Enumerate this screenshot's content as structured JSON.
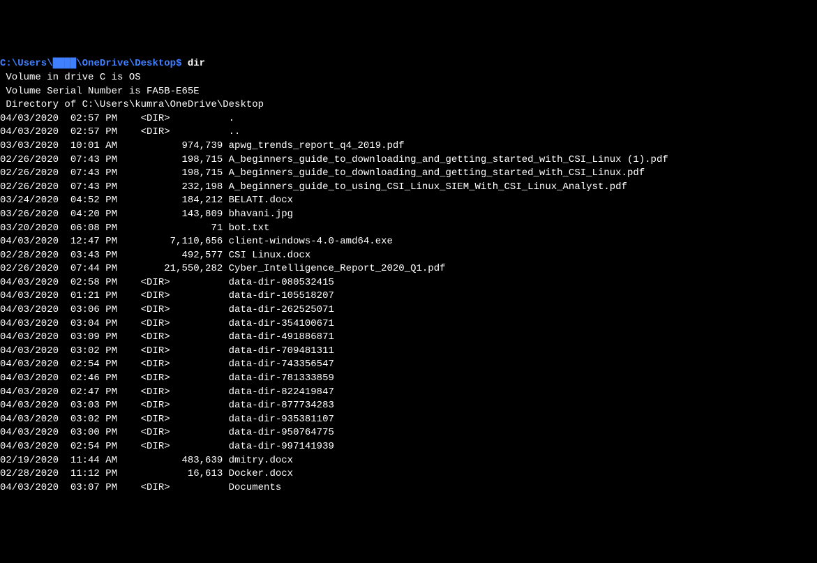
{
  "prompt": {
    "prefix": "C:\\Users\\",
    "obscured": "████",
    "suffix": "\\OneDrive\\Desktop",
    "dollar": "$",
    "command": "dir"
  },
  "header": {
    "volume_label": " Volume in drive C is OS",
    "serial": " Volume Serial Number is FA5B-E65E",
    "blank": "",
    "directory_of": " Directory of C:\\Users\\kumra\\OneDrive\\Desktop",
    "blank2": ""
  },
  "entries": [
    {
      "date": "04/03/2020",
      "time": "02:57 PM",
      "dir": "<DIR>",
      "size": "",
      "name": "."
    },
    {
      "date": "04/03/2020",
      "time": "02:57 PM",
      "dir": "<DIR>",
      "size": "",
      "name": ".."
    },
    {
      "date": "03/03/2020",
      "time": "10:01 AM",
      "dir": "",
      "size": "974,739",
      "name": "apwg_trends_report_q4_2019.pdf"
    },
    {
      "date": "02/26/2020",
      "time": "07:43 PM",
      "dir": "",
      "size": "198,715",
      "name": "A_beginners_guide_to_downloading_and_getting_started_with_CSI_Linux (1).pdf"
    },
    {
      "date": "02/26/2020",
      "time": "07:43 PM",
      "dir": "",
      "size": "198,715",
      "name": "A_beginners_guide_to_downloading_and_getting_started_with_CSI_Linux.pdf"
    },
    {
      "date": "02/26/2020",
      "time": "07:43 PM",
      "dir": "",
      "size": "232,198",
      "name": "A_beginners_guide_to_using_CSI_Linux_SIEM_With_CSI_Linux_Analyst.pdf"
    },
    {
      "date": "03/24/2020",
      "time": "04:52 PM",
      "dir": "",
      "size": "184,212",
      "name": "BELATI.docx"
    },
    {
      "date": "03/26/2020",
      "time": "04:20 PM",
      "dir": "",
      "size": "143,809",
      "name": "bhavani.jpg"
    },
    {
      "date": "03/20/2020",
      "time": "06:08 PM",
      "dir": "",
      "size": "71",
      "name": "bot.txt"
    },
    {
      "date": "04/03/2020",
      "time": "12:47 PM",
      "dir": "",
      "size": "7,110,656",
      "name": "client-windows-4.0-amd64.exe"
    },
    {
      "date": "02/28/2020",
      "time": "03:43 PM",
      "dir": "",
      "size": "492,577",
      "name": "CSI Linux.docx"
    },
    {
      "date": "02/26/2020",
      "time": "07:44 PM",
      "dir": "",
      "size": "21,550,282",
      "name": "Cyber_Intelligence_Report_2020_Q1.pdf"
    },
    {
      "date": "04/03/2020",
      "time": "02:58 PM",
      "dir": "<DIR>",
      "size": "",
      "name": "data-dir-080532415"
    },
    {
      "date": "04/03/2020",
      "time": "01:21 PM",
      "dir": "<DIR>",
      "size": "",
      "name": "data-dir-105518207"
    },
    {
      "date": "04/03/2020",
      "time": "03:06 PM",
      "dir": "<DIR>",
      "size": "",
      "name": "data-dir-262525071"
    },
    {
      "date": "04/03/2020",
      "time": "03:04 PM",
      "dir": "<DIR>",
      "size": "",
      "name": "data-dir-354100671"
    },
    {
      "date": "04/03/2020",
      "time": "03:09 PM",
      "dir": "<DIR>",
      "size": "",
      "name": "data-dir-491886871"
    },
    {
      "date": "04/03/2020",
      "time": "03:02 PM",
      "dir": "<DIR>",
      "size": "",
      "name": "data-dir-709481311"
    },
    {
      "date": "04/03/2020",
      "time": "02:54 PM",
      "dir": "<DIR>",
      "size": "",
      "name": "data-dir-743356547"
    },
    {
      "date": "04/03/2020",
      "time": "02:46 PM",
      "dir": "<DIR>",
      "size": "",
      "name": "data-dir-781333859"
    },
    {
      "date": "04/03/2020",
      "time": "02:47 PM",
      "dir": "<DIR>",
      "size": "",
      "name": "data-dir-822419847"
    },
    {
      "date": "04/03/2020",
      "time": "03:03 PM",
      "dir": "<DIR>",
      "size": "",
      "name": "data-dir-877734283"
    },
    {
      "date": "04/03/2020",
      "time": "03:02 PM",
      "dir": "<DIR>",
      "size": "",
      "name": "data-dir-935381107"
    },
    {
      "date": "04/03/2020",
      "time": "03:00 PM",
      "dir": "<DIR>",
      "size": "",
      "name": "data-dir-950764775"
    },
    {
      "date": "04/03/2020",
      "time": "02:54 PM",
      "dir": "<DIR>",
      "size": "",
      "name": "data-dir-997141939"
    },
    {
      "date": "02/19/2020",
      "time": "11:44 AM",
      "dir": "",
      "size": "483,639",
      "name": "dmitry.docx"
    },
    {
      "date": "02/28/2020",
      "time": "11:12 PM",
      "dir": "",
      "size": "16,613",
      "name": "Docker.docx"
    },
    {
      "date": "04/03/2020",
      "time": "03:07 PM",
      "dir": "<DIR>",
      "size": "",
      "name": "Documents"
    }
  ]
}
